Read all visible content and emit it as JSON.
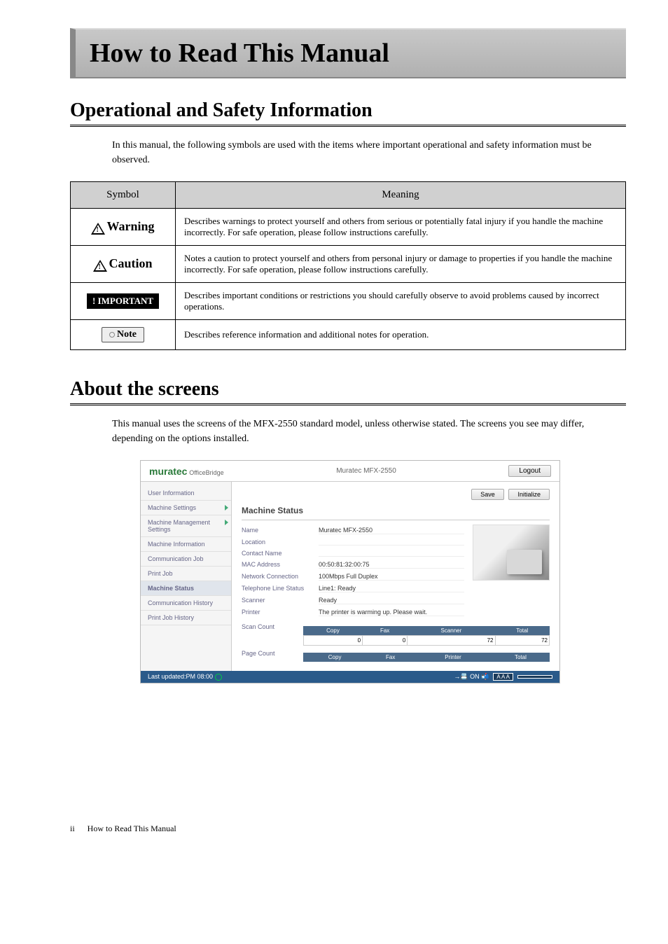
{
  "page": {
    "title": "How to Read This Manual",
    "footer_num": "ii",
    "footer_text": "How to Read This Manual"
  },
  "section1": {
    "heading": "Operational and Safety Information",
    "intro": "In this manual, the following symbols are used with the items where important operational and safety information must be observed."
  },
  "table": {
    "col1": "Symbol",
    "col2": "Meaning",
    "rows": [
      {
        "sym": "Warning",
        "meaning": "Describes warnings to protect yourself and others from serious or potentially fatal injury if you handle the machine incorrectly. For safe operation, please follow instructions carefully."
      },
      {
        "sym": "Caution",
        "meaning": "Notes a caution to protect yourself and others from personal injury or damage to properties if you handle the machine incorrectly. For safe operation, please follow instructions carefully."
      },
      {
        "sym": "! IMPORTANT",
        "meaning": "Describes important conditions or restrictions you should carefully observe to avoid problems caused by incorrect operations."
      },
      {
        "sym": "Note",
        "meaning": "Describes reference information and additional notes for operation."
      }
    ]
  },
  "section2": {
    "heading": "About the screens",
    "intro": "This manual uses the screens of the MFX-2550 standard model, unless otherwise stated. The screens you see may differ, depending on the options installed."
  },
  "screenshot": {
    "logo": "muratec",
    "logo_sub": "OfficeBridge",
    "model": "Muratec MFX-2550",
    "logout": "Logout",
    "sidebar": [
      "User Information",
      "Machine Settings",
      "Machine Management Settings",
      "Machine Information",
      "Communication Job",
      "Print Job",
      "Machine Status",
      "Communication History",
      "Print Job History"
    ],
    "btn_save": "Save",
    "btn_init": "Initialize",
    "main_title": "Machine Status",
    "status": {
      "name_lbl": "Name",
      "name_val": "Muratec MFX-2550",
      "location_lbl": "Location",
      "location_val": "",
      "contact_lbl": "Contact Name",
      "contact_val": "",
      "mac_lbl": "MAC Address",
      "mac_val": "00:50:81:32:00:75",
      "net_lbl": "Network Connection",
      "net_val": "100Mbps   Full Duplex",
      "tel_lbl": "Telephone Line Status",
      "tel_val": "Line1: Ready",
      "scan_lbl": "Scanner",
      "scan_val": "Ready",
      "print_lbl": "Printer",
      "print_val": "The printer is warming up. Please wait."
    },
    "scan_count_lbl": "Scan Count",
    "page_count_lbl": "Page Count",
    "count_headers": [
      "Copy",
      "Fax",
      "Scanner",
      "Total"
    ],
    "count_headers2": [
      "Copy",
      "Fax",
      "Printer",
      "Total"
    ],
    "count_values": [
      "0",
      "0",
      "72",
      "72"
    ],
    "footer_time": "Last updated:PM 08:00",
    "footer_on": "ON",
    "footer_aaa": "A  A  A"
  }
}
